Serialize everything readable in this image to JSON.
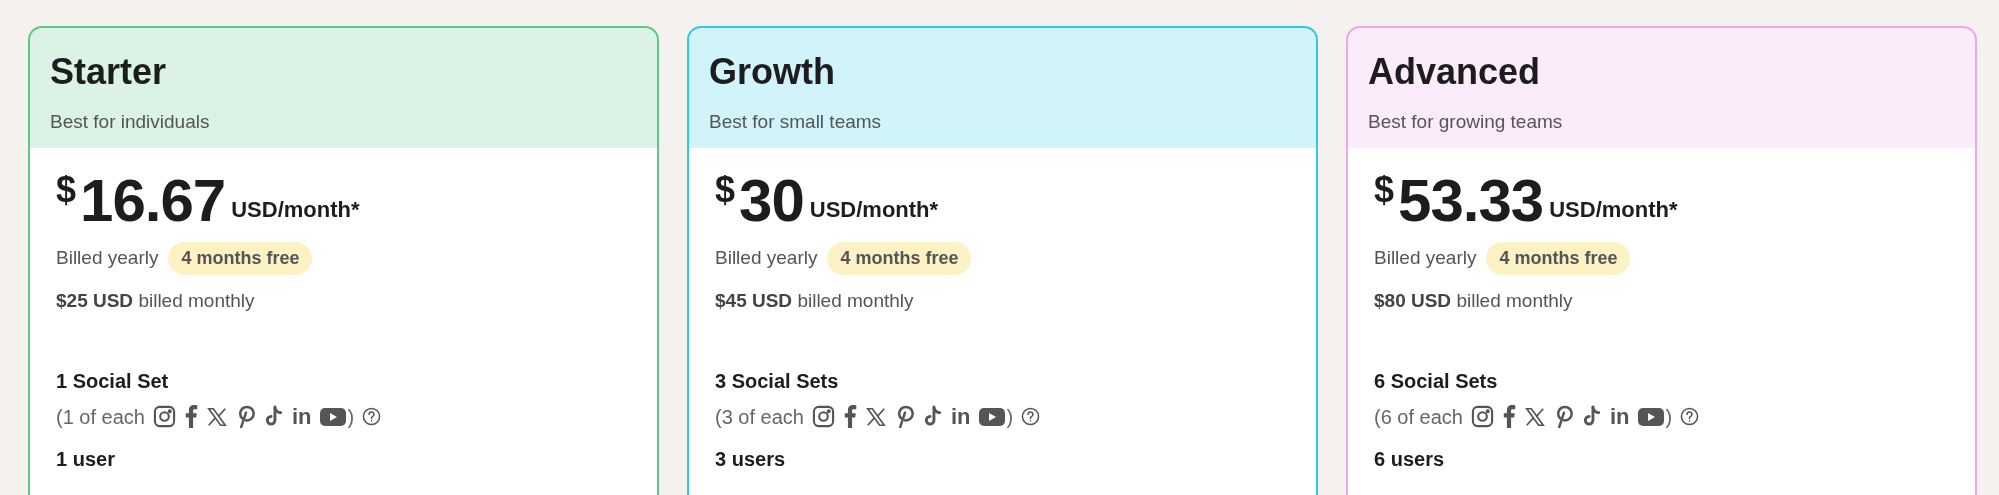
{
  "plans": [
    {
      "name": "Starter",
      "tagline": "Best for individuals",
      "color": "#5cc98a",
      "currency": "$",
      "price": "16.67",
      "unit": "USD/month*",
      "billing": "Billed yearly",
      "badge": "4 months free",
      "monthly_bold": "$25 USD",
      "monthly_rest": "billed monthly",
      "sets": "1 Social Set",
      "each_open": "(1 of each",
      "linkedin": "in",
      "each_close": ")",
      "users": "1 user"
    },
    {
      "name": "Growth",
      "tagline": "Best for small teams",
      "color": "#2fc7ea",
      "currency": "$",
      "price": "30",
      "unit": "USD/month*",
      "billing": "Billed yearly",
      "badge": "4 months free",
      "monthly_bold": "$45 USD",
      "monthly_rest": "billed monthly",
      "sets": "3 Social Sets",
      "each_open": "(3 of each",
      "linkedin": "in",
      "each_close": ")",
      "users": "3 users"
    },
    {
      "name": "Advanced",
      "tagline": "Best for growing teams",
      "color": "#f0a6ec",
      "currency": "$",
      "price": "53.33",
      "unit": "USD/month*",
      "billing": "Billed yearly",
      "badge": "4 months free",
      "monthly_bold": "$80 USD",
      "monthly_rest": "billed monthly",
      "sets": "6 Social Sets",
      "each_open": "(6 of each",
      "linkedin": "in",
      "each_close": ")",
      "users": "6 users"
    }
  ]
}
